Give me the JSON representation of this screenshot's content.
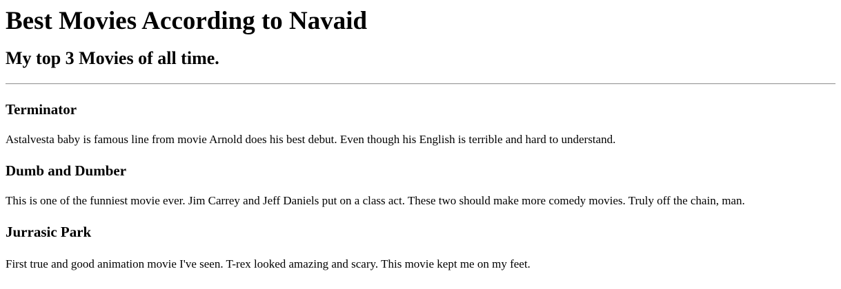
{
  "page": {
    "title": "Best Movies According to Navaid",
    "subtitle": "My top 3 Movies of all time."
  },
  "movies": [
    {
      "title": "Terminator",
      "description": "Astalvesta baby is famous line from movie Arnold does his best debut. Even though his English is terrible and hard to understand."
    },
    {
      "title": "Dumb and Dumber",
      "description": "This is one of the funniest movie ever. Jim Carrey and Jeff Daniels put on a class act. These two should make more comedy movies. Truly off the chain, man."
    },
    {
      "title": "Jurrasic Park",
      "description": "First true and good animation movie I've seen. T-rex looked amazing and scary. This movie kept me on my feet."
    }
  ]
}
